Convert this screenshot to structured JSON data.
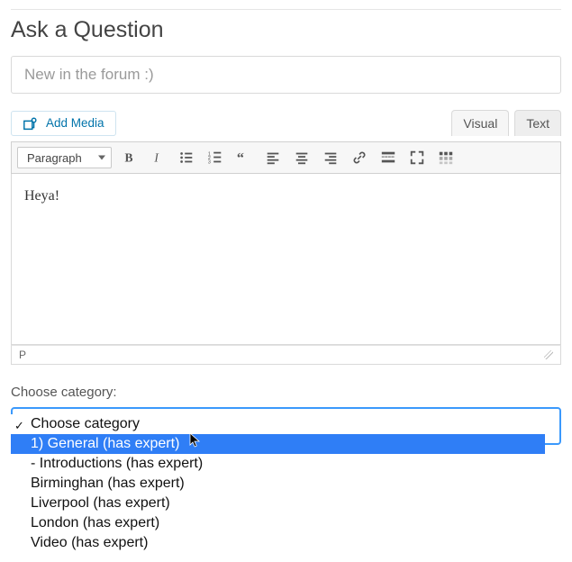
{
  "page": {
    "title": "Ask a Question"
  },
  "form": {
    "title_placeholder": "New in the forum :)",
    "title_value": ""
  },
  "editor": {
    "add_media_label": "Add Media",
    "tabs": {
      "visual": "Visual",
      "text": "Text"
    },
    "format_dropdown": "Paragraph",
    "content": "Heya!",
    "status_path": "P"
  },
  "category": {
    "label": "Choose category:",
    "placeholder": "Choose category",
    "options": [
      "1) General (has expert)",
      "  - Introductions (has expert)",
      "Birminghan (has expert)",
      "Liverpool (has expert)",
      "London (has expert)",
      "Video (has expert)"
    ],
    "highlighted_index": 0
  }
}
